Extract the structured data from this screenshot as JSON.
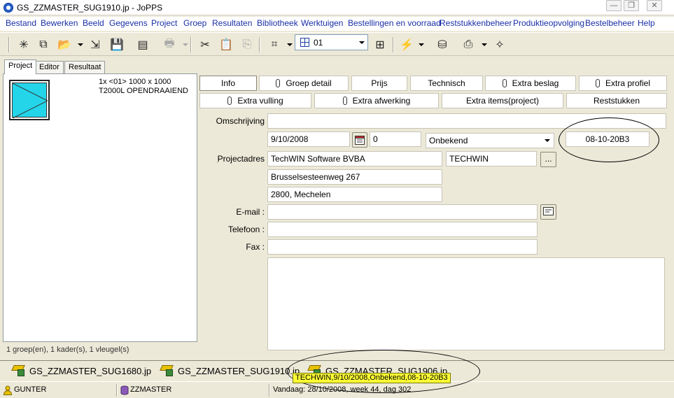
{
  "window": {
    "title": "GS_ZZMASTER_SUG1910.jp - JoPPS"
  },
  "menu": [
    "Bestand",
    "Bewerken",
    "Beeld",
    "Gegevens",
    "Project",
    "Groep",
    "Resultaten",
    "Bibliotheek",
    "Werktuigen",
    "Bestellingen en voorraad",
    "Reststukkenbeheer",
    "Produktieopvolging",
    "Bestelbeheer",
    "Help"
  ],
  "toolbar": {
    "combo_value": "01"
  },
  "left_tabs": [
    "Project",
    "Editor",
    "Resultaat"
  ],
  "element": {
    "line1": "1x <01> 1000 x 1000",
    "line2": "T2000L OPENDRAAIEND"
  },
  "left_status": "1 groep(en), 1 kader(s), 1 vleugel(s)",
  "detail_tabs_row1": [
    "Info",
    "Groep detail",
    "Prijs",
    "Technisch",
    "Extra beslag",
    "Extra profiel"
  ],
  "detail_tabs_row2": [
    "Extra vulling",
    "Extra afwerking",
    "Extra items(project)",
    "Reststukken"
  ],
  "form": {
    "omschrijving_label": "Omschrijving",
    "omschrijving": "",
    "date": "9/10/2008",
    "number": "0",
    "status": "Onbekend",
    "code": "08-10-20B3",
    "projectadres_label": "Projectadres",
    "company": "TechWIN Software BVBA",
    "short_name": "TECHWIN",
    "ellipsis_button": "...",
    "street": "Brusselsesteenweg 267",
    "city": "2800, Mechelen",
    "email_label": "E-mail :",
    "email": "",
    "telefoon_label": "Telefoon :",
    "telefoon": "",
    "fax_label": "Fax :",
    "fax": "",
    "notes": ""
  },
  "doc_tabs": [
    "GS_ZZMASTER_SUG1680.jp",
    "GS_ZZMASTER_SUG1910.jp",
    "GS_ZZMASTER_SUG1906.jp"
  ],
  "tooltip": "TECHWIN,9/10/2008,Onbekend,08-10-20B3",
  "statusbar": {
    "user": "GUNTER",
    "database": "ZZMASTER",
    "today": "Vandaag: 28/10/2008, week 44, dag 302"
  }
}
